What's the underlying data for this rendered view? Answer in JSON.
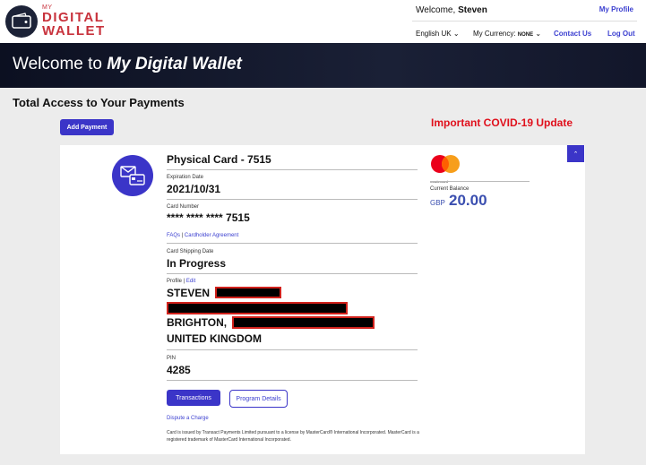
{
  "brand": {
    "my": "MY",
    "line1": "DIGITAL",
    "line2": "WALLET"
  },
  "header": {
    "welcome_prefix": "Welcome,",
    "user_name": "Steven",
    "my_profile": "My Profile",
    "language": "English UK",
    "currency_label": "My Currency:",
    "currency_value": "NONE",
    "contact_us": "Contact Us",
    "logout": "Log Out"
  },
  "banner": {
    "prefix": "Welcome to ",
    "emphasis": "My Digital Wallet"
  },
  "page": {
    "section_title": "Total Access to Your Payments",
    "add_payment": "Add Payment",
    "covid_notice": "Important COVID-19 Update"
  },
  "card": {
    "title": "Physical Card - 7515",
    "expiration_label": "Expiration Date",
    "expiration_value": "2021/10/31",
    "number_label": "Card Number",
    "number_value": "**** **** **** 7515",
    "faqs": "FAQs",
    "separator": "|",
    "agreement": "Cardholder Agreement",
    "shipping_label": "Card Shipping Date",
    "shipping_value": "In Progress",
    "profile_label": "Profile",
    "edit": "Edit",
    "name_line": "STEVEN",
    "city_line": "BRIGHTON,",
    "country_line": "UNITED KINGDOM",
    "pin_label": "PIN",
    "pin_value": "4285",
    "transactions": "Transactions",
    "program_details": "Program Details",
    "dispute": "Dispute a Charge",
    "disclaimer": "Card is issued by Transact Payments Limited pursuant to a license by MasterCard® International Incorporated. MasterCard is a registered trademark of MasterCard International Incorporated.",
    "network": "mastercard",
    "balance_label": "Current Balance",
    "balance_currency": "GBP",
    "balance_amount": "20.00"
  },
  "colors": {
    "accent": "#3b35c8",
    "brand_red": "#c8323c",
    "alert": "#e0101c",
    "banner": "#12162a"
  }
}
